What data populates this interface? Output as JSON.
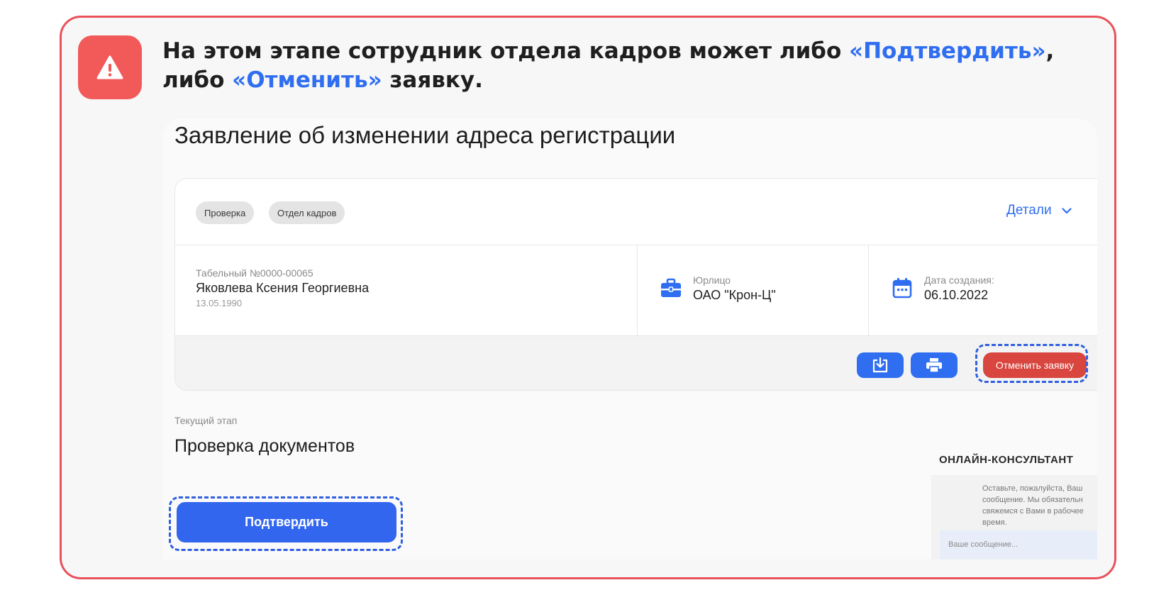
{
  "callout": {
    "line1_prefix": "На этом этапе сотрудник отдела кадров может либо ",
    "line1_highlight": "«Подтвердить»",
    "line1_suffix": ",",
    "line2_prefix": "либо ",
    "line2_highlight": "«Отменить»",
    "line2_suffix": " заявку.",
    "icon": "warning-triangle-icon",
    "accent_color": "#f25a5a",
    "highlight_color": "#2f6ef0"
  },
  "screen": {
    "title": "Заявление об изменении адреса регистрации",
    "tags": [
      "Проверка",
      "Отдел кадров"
    ],
    "details_label": "Детали",
    "employee": {
      "tab_number": "Табельный №0000-00065",
      "name": "Яковлева Ксения Георгиевна",
      "birth_date": "13.05.1990"
    },
    "entity": {
      "label": "Юрлицо",
      "value": "ОАО \"Крон-Ц\"",
      "icon": "briefcase-icon"
    },
    "created": {
      "label": "Дата создания:",
      "value": "06.10.2022",
      "icon": "calendar-icon"
    },
    "actions": {
      "download_icon": "download-icon",
      "print_icon": "printer-icon",
      "cancel_label": "Отменить заявку"
    },
    "stage": {
      "label": "Текущий этап",
      "value": "Проверка документов"
    },
    "confirm_label": "Подтвердить",
    "consultant": {
      "title": "ОНЛАЙН-КОНСУЛЬТАНТ",
      "message": "Оставьте, пожалуйста, Ваш сообщение. Мы обязательн свяжемся с Вами в рабочее время.",
      "input_placeholder": "Ваше сообщение..."
    },
    "colors": {
      "primary": "#2f6ef0",
      "danger": "#d8463f",
      "highlight_dash": "#2f5fe0"
    }
  }
}
